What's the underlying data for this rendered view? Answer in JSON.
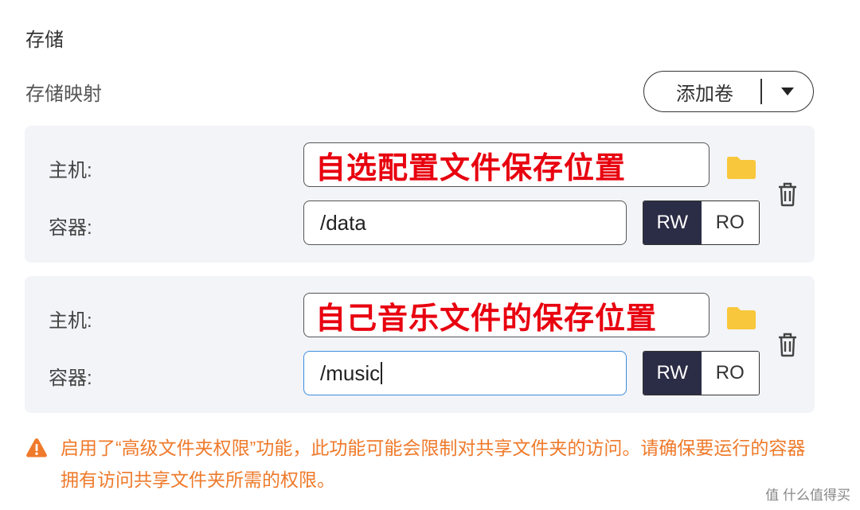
{
  "section_title": "存储",
  "subtitle": "存储映射",
  "add_volume": {
    "label": "添加卷",
    "arrow_icon": "caret-down-icon"
  },
  "mappings": [
    {
      "host_label": "主机:",
      "host_annotation": "自选配置文件保存位置",
      "container_label": "容器:",
      "container_path": "/data",
      "mode_rw": "RW",
      "mode_ro": "RO",
      "selected_mode": "RW"
    },
    {
      "host_label": "主机:",
      "host_annotation": "自己音乐文件的保存位置",
      "container_label": "容器:",
      "container_path": "/music",
      "mode_rw": "RW",
      "mode_ro": "RO",
      "selected_mode": "RW"
    }
  ],
  "warning": {
    "text": "启用了“高级文件夹权限”功能，此功能可能会限制对共享文件夹的访问。请确保要运行的容器拥有访问共享文件夹所需的权限。"
  },
  "watermark": "值 什么值得买",
  "colors": {
    "accent_dark": "#2b2c45",
    "warning": "#ef7a2b",
    "folder": "#f8c73b",
    "annotation_red": "#e8000f",
    "focus_border": "#3a8de0"
  }
}
